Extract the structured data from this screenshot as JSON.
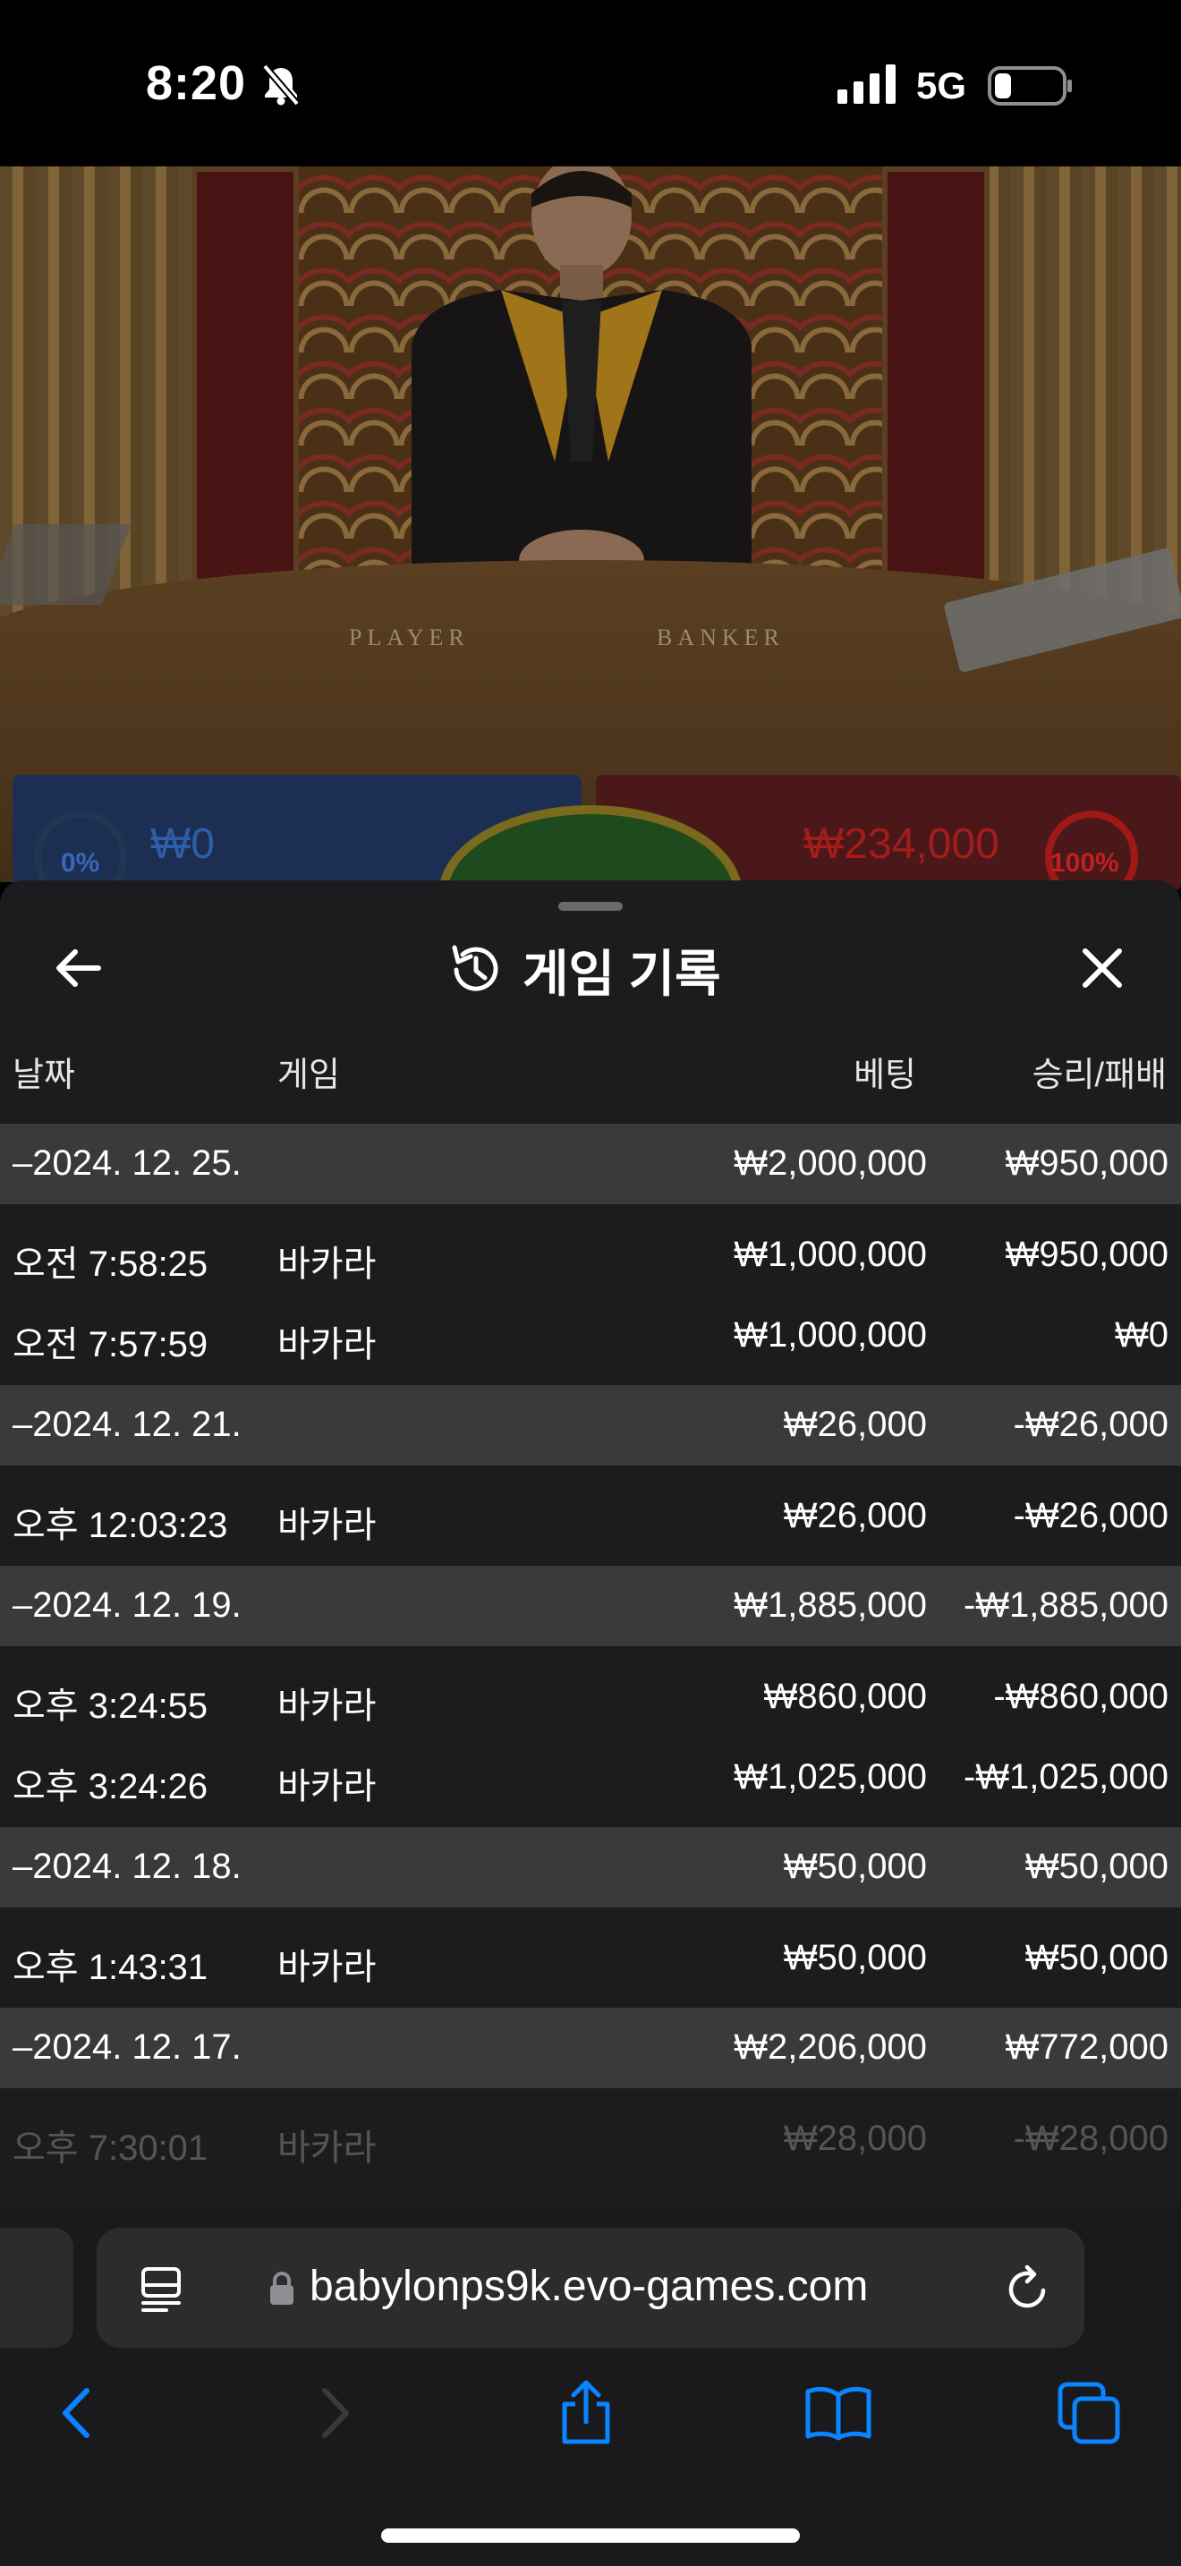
{
  "status_bar": {
    "time": "8:20",
    "network": "5G"
  },
  "video": {
    "table_labels": {
      "player": "PLAYER",
      "banker": "BANKER"
    },
    "player_bet": {
      "percent": "0%",
      "amount": "₩0"
    },
    "banker_bet": {
      "percent": "100%",
      "amount": "₩234,000"
    }
  },
  "sheet": {
    "title": "게임 기록",
    "columns": {
      "date": "날짜",
      "game": "게임",
      "bet": "베팅",
      "win_loss": "승리/패배"
    },
    "groups": [
      {
        "date": "–2024. 12. 25.",
        "bet": "₩2,000,000",
        "win_loss": "₩950,000",
        "entries": [
          {
            "time": "오전 7:58:25",
            "game": "바카라",
            "bet": "₩1,000,000",
            "win_loss": "₩950,000"
          },
          {
            "time": "오전 7:57:59",
            "game": "바카라",
            "bet": "₩1,000,000",
            "win_loss": "₩0"
          }
        ]
      },
      {
        "date": "–2024. 12. 21.",
        "bet": "₩26,000",
        "win_loss": "-₩26,000",
        "entries": [
          {
            "time": "오후 12:03:23",
            "game": "바카라",
            "bet": "₩26,000",
            "win_loss": "-₩26,000"
          }
        ]
      },
      {
        "date": "–2024. 12. 19.",
        "bet": "₩1,885,000",
        "win_loss": "-₩1,885,000",
        "entries": [
          {
            "time": "오후 3:24:55",
            "game": "바카라",
            "bet": "₩860,000",
            "win_loss": "-₩860,000"
          },
          {
            "time": "오후 3:24:26",
            "game": "바카라",
            "bet": "₩1,025,000",
            "win_loss": "-₩1,025,000"
          }
        ]
      },
      {
        "date": "–2024. 12. 18.",
        "bet": "₩50,000",
        "win_loss": "₩50,000",
        "entries": [
          {
            "time": "오후 1:43:31",
            "game": "바카라",
            "bet": "₩50,000",
            "win_loss": "₩50,000"
          }
        ]
      },
      {
        "date": "–2024. 12. 17.",
        "bet": "₩2,206,000",
        "win_loss": "₩772,000",
        "entries": [
          {
            "time": "오후 7:30:01",
            "game": "바카라",
            "bet": "₩28,000",
            "win_loss": "-₩28,000"
          }
        ]
      }
    ]
  },
  "browser": {
    "url": "babylonps9k.evo-games.com"
  },
  "colors": {
    "accent": "#0a84ff",
    "sheet_bg": "#1c1c1e",
    "group_row_bg": "#3a3a3c"
  }
}
